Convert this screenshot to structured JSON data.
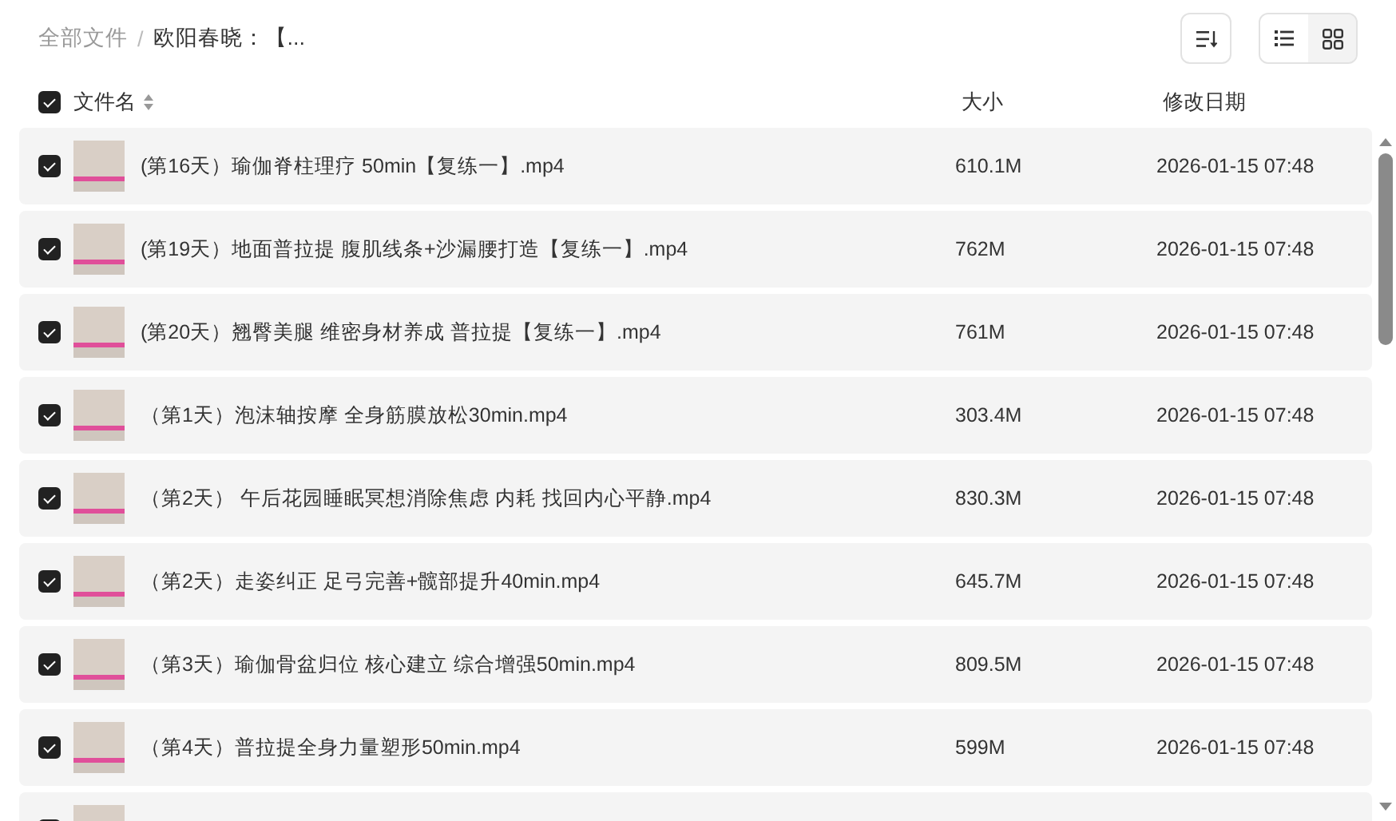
{
  "breadcrumb": {
    "separator": "/",
    "items": [
      {
        "label": "全部文件",
        "current": false
      },
      {
        "label": "欧阳春晓：【...",
        "current": true
      }
    ]
  },
  "toolbar": {
    "view_modes": [
      {
        "kind": "list",
        "selected": true
      },
      {
        "kind": "grid",
        "selected": false
      }
    ]
  },
  "select_all": {
    "checked": true
  },
  "columns": [
    {
      "label": "文件名",
      "sortable": true
    },
    {
      "label": "大小",
      "sortable": false
    },
    {
      "label": "修改日期",
      "sortable": false
    }
  ],
  "rows": [
    {
      "name": "(第16天）瑜伽脊柱理疗 50min【复练一】.mp4",
      "size": "610.1M",
      "modified": "2026-01-15 07:48",
      "checked": true
    },
    {
      "name": "(第19天）地面普拉提 腹肌线条+沙漏腰打造【复练一】.mp4",
      "size": "762M",
      "modified": "2026-01-15 07:48",
      "checked": true
    },
    {
      "name": "(第20天）翘臀美腿 维密身材养成 普拉提【复练一】.mp4",
      "size": "761M",
      "modified": "2026-01-15 07:48",
      "checked": true
    },
    {
      "name": "（第1天）泡沫轴按摩 全身筋膜放松30min.mp4",
      "size": "303.4M",
      "modified": "2026-01-15 07:48",
      "checked": true
    },
    {
      "name": "（第2天） 午后花园睡眠冥想消除焦虑 内耗 找回内心平静.mp4",
      "size": "830.3M",
      "modified": "2026-01-15 07:48",
      "checked": true
    },
    {
      "name": "（第2天）走姿纠正 足弓完善+髋部提升40min.mp4",
      "size": "645.7M",
      "modified": "2026-01-15 07:48",
      "checked": true
    },
    {
      "name": "（第3天）瑜伽骨盆归位 核心建立 综合增强50min.mp4",
      "size": "809.5M",
      "modified": "2026-01-15 07:48",
      "checked": true
    },
    {
      "name": "（第4天）普拉提全身力量塑形50min.mp4",
      "size": "599M",
      "modified": "2026-01-15 07:48",
      "checked": true
    },
    {
      "checked": true
    }
  ]
}
